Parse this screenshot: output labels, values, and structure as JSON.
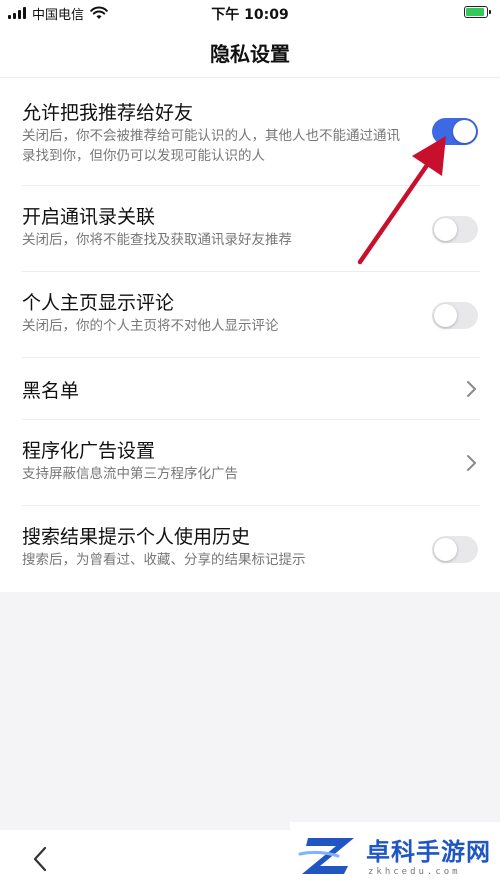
{
  "status_bar": {
    "carrier": "中国电信",
    "time": "下午 10:09",
    "battery_charging": true
  },
  "header": {
    "title": "隐私设置"
  },
  "settings": [
    {
      "title": "允许把我推荐给好友",
      "description": "关闭后，你不会被推荐给可能认识的人，其他人也不能通过通讯录找到你，但你仍可以发现可能认识的人",
      "control": "toggle",
      "enabled": true
    },
    {
      "title": "开启通讯录关联",
      "description": "关闭后，你将不能查找及获取通讯录好友推荐",
      "control": "toggle",
      "enabled": false
    },
    {
      "title": "个人主页显示评论",
      "description": "关闭后，你的个人主页将不对他人显示评论",
      "control": "toggle",
      "enabled": false
    },
    {
      "title": "黑名单",
      "control": "chevron"
    },
    {
      "title": "程序化广告设置",
      "description": "支持屏蔽信息流中第三方程序化广告",
      "control": "chevron"
    },
    {
      "title": "搜索结果提示个人使用历史",
      "description": "搜索后，为曾看过、收藏、分享的结果标记提示",
      "control": "toggle",
      "enabled": false
    }
  ],
  "watermark": {
    "name": "卓科手游网",
    "domain": "zkhcedu.com"
  },
  "colors": {
    "toggle_on": "#3e69e5",
    "toggle_off": "#e8e8ea",
    "annotation_arrow": "#c8102e",
    "watermark_blue": "#1f56c2"
  },
  "icons": {
    "back": "chevron-left-icon",
    "row_chevron": "chevron-right-icon",
    "wifi": "wifi-icon",
    "battery": "battery-charging-icon",
    "signal": "cellular-signal-icon"
  }
}
